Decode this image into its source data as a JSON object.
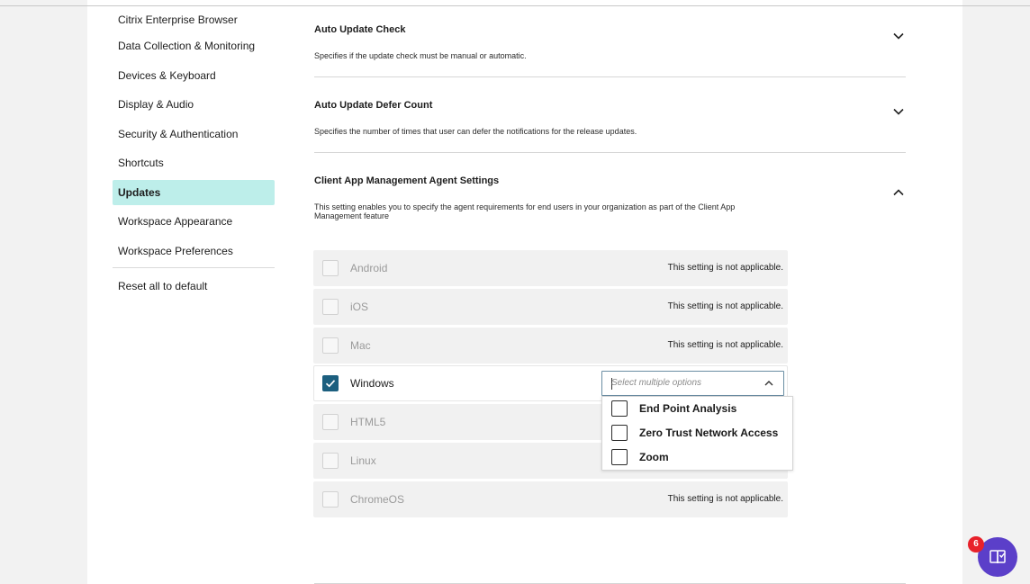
{
  "sidebar": {
    "items": [
      {
        "label": "Citrix Enterprise Browser"
      },
      {
        "label": "Data Collection & Monitoring"
      },
      {
        "label": "Devices & Keyboard"
      },
      {
        "label": "Display & Audio"
      },
      {
        "label": "Security & Authentication"
      },
      {
        "label": "Shortcuts"
      },
      {
        "label": "Updates",
        "active": true
      },
      {
        "label": "Workspace Appearance"
      },
      {
        "label": "Workspace Preferences"
      }
    ],
    "reset_label": "Reset all to default"
  },
  "sections": [
    {
      "title": "Auto Update Check",
      "description": "Specifies if the update check must be manual or automatic.",
      "expanded": false
    },
    {
      "title": "Auto Update Defer Count",
      "description": "Specifies the number of times that user can defer the notifications for the release updates.",
      "expanded": false
    },
    {
      "title": "Client App Management Agent Settings",
      "description": "This setting enables you to specify the agent requirements for end users in your organization as part of the Client App Management feature",
      "expanded": true
    }
  ],
  "platforms": [
    {
      "label": "Android",
      "checked": false,
      "note": "This setting is not applicable."
    },
    {
      "label": "iOS",
      "checked": false,
      "note": "This setting is not applicable."
    },
    {
      "label": "Mac",
      "checked": false,
      "note": "This setting is not applicable."
    },
    {
      "label": "Windows",
      "checked": true,
      "note": ""
    },
    {
      "label": "HTML5",
      "checked": false,
      "note": ""
    },
    {
      "label": "Linux",
      "checked": false,
      "note": ""
    },
    {
      "label": "ChromeOS",
      "checked": false,
      "note": "This setting is not applicable."
    }
  ],
  "dropdown": {
    "placeholder": "Select multiple options",
    "options": [
      {
        "label": "End Point Analysis",
        "checked": false
      },
      {
        "label": "Zero Trust Network Access",
        "checked": false
      },
      {
        "label": "Zoom",
        "checked": false
      }
    ]
  },
  "help": {
    "badge_count": "6",
    "icon": "help-book-icon"
  },
  "colors": {
    "active_item": "#bdeeea",
    "checkbox_checked": "#1c5f7f",
    "help_button": "#5b3fc9",
    "badge": "#e8212a"
  }
}
